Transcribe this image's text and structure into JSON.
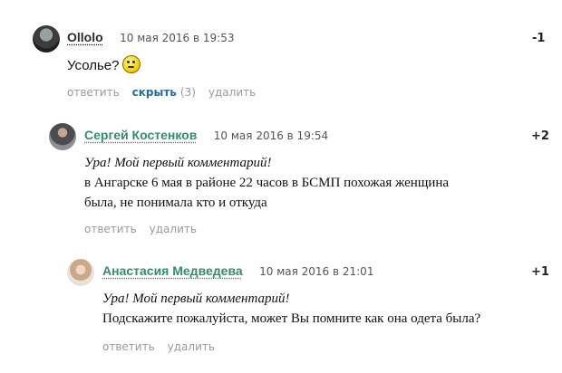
{
  "comments": [
    {
      "author": "Ollolo",
      "date": "10 мая 2016 в 19:53",
      "score": "-1",
      "text": "Усолье?",
      "emoji": "confused-smiley-icon",
      "actions": {
        "reply": "ответить",
        "hide": "скрыть",
        "hide_count": "(3)",
        "delete": "удалить"
      }
    },
    {
      "author": "Сергей Костенков",
      "date": "10 мая 2016 в 19:54",
      "score": "+2",
      "first_comment": "Ура! Мой первый комментарий!",
      "text_lines": [
        "в Ангарске 6 мая в районе 22 часов в БСМП похожая женщина",
        "была, не понимала кто и откуда"
      ],
      "actions": {
        "reply": "ответить",
        "delete": "удалить"
      }
    },
    {
      "author": "Анастасия Медведева",
      "date": "10 мая 2016 в 21:01",
      "score": "+1",
      "first_comment": "Ура! Мой первый комментарий!",
      "text_lines": [
        "Подскажите пожалуйста, может Вы помните как она одета была?"
      ],
      "actions": {
        "reply": "ответить",
        "delete": "удалить"
      }
    }
  ],
  "colors": {
    "author_dark": "#2b2b2b",
    "author_green": "#2f8f6f",
    "hide_link": "#1f6fa8",
    "muted": "#9a9a9a"
  }
}
